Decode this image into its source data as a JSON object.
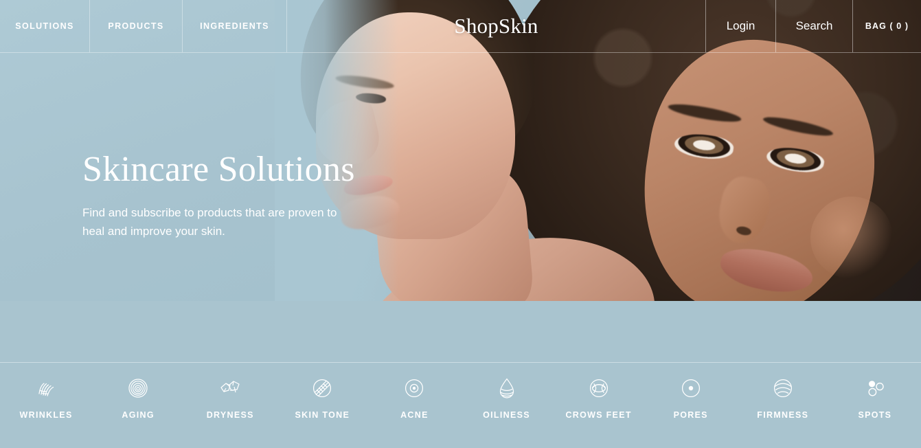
{
  "brand": {
    "logo_text": "ShopSkin"
  },
  "header": {
    "nav_left": [
      {
        "label": "SOLUTIONS",
        "name": "nav-solutions"
      },
      {
        "label": "PRODUCTS",
        "name": "nav-products"
      },
      {
        "label": "INGREDIENTS",
        "name": "nav-ingredients"
      }
    ],
    "nav_right": [
      {
        "label": "Login",
        "name": "nav-login"
      },
      {
        "label": "Search",
        "name": "nav-search"
      },
      {
        "label": "BAG ( 0 )",
        "name": "nav-bag"
      }
    ],
    "bag_count": 0
  },
  "hero": {
    "title": "Skincare Solutions",
    "subtitle": "Find and subscribe to products that are proven to heal and improve your skin."
  },
  "concerns": [
    {
      "label": "WRINKLES",
      "icon": "wrinkles-icon"
    },
    {
      "label": "AGING",
      "icon": "aging-rings-icon"
    },
    {
      "label": "DRYNESS",
      "icon": "dryness-flakes-icon"
    },
    {
      "label": "SKIN TONE",
      "icon": "skin-tone-icon"
    },
    {
      "label": "ACNE",
      "icon": "acne-icon"
    },
    {
      "label": "OILINESS",
      "icon": "oiliness-droplet-icon"
    },
    {
      "label": "CROWS FEET",
      "icon": "crows-feet-eye-icon"
    },
    {
      "label": "PORES",
      "icon": "pores-icon"
    },
    {
      "label": "FIRMNESS",
      "icon": "firmness-icon"
    },
    {
      "label": "SPOTS",
      "icon": "spots-icon"
    }
  ],
  "colors": {
    "page_blue": "#a9c4cf",
    "hero_blue": "#a9c6d2",
    "text_white": "#ffffff",
    "divider": "rgba(255,255,255,0.42)"
  }
}
